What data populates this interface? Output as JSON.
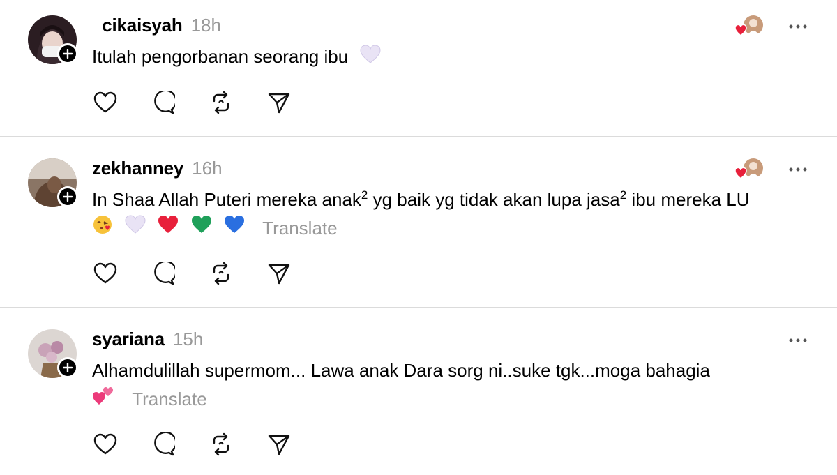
{
  "posts": [
    {
      "username": "_cikaisyah",
      "time": "18h",
      "text": "Itulah pengorbanan seorang ibu",
      "text_emojis": [
        "white-heart"
      ],
      "has_liker_avatar": true
    },
    {
      "username": "zekhanney",
      "time": "16h",
      "text_before_sup1": "In Shaa Allah Puteri mereka anak",
      "sup1": "2",
      "text_mid": " yg baik yg tidak akan lupa jasa",
      "sup2": "2",
      "text_after": " ibu mereka LU",
      "line2_emojis": [
        "kiss-face",
        "white-heart",
        "red-heart",
        "green-heart",
        "blue-heart"
      ],
      "translate": "Translate",
      "has_liker_avatar": true
    },
    {
      "username": "syariana",
      "time": "15h",
      "text": "Alhamdulillah supermom... Lawa anak Dara sorg ni..suke tgk...moga bahagia",
      "line2_emojis": [
        "two-hearts"
      ],
      "translate": "Translate",
      "has_liker_avatar": false
    }
  ],
  "actions": [
    "like",
    "reply",
    "repost",
    "share"
  ],
  "colors": {
    "heart_red": "#e8203b",
    "translate_grey": "#999999",
    "divider": "#dbdbdb"
  }
}
